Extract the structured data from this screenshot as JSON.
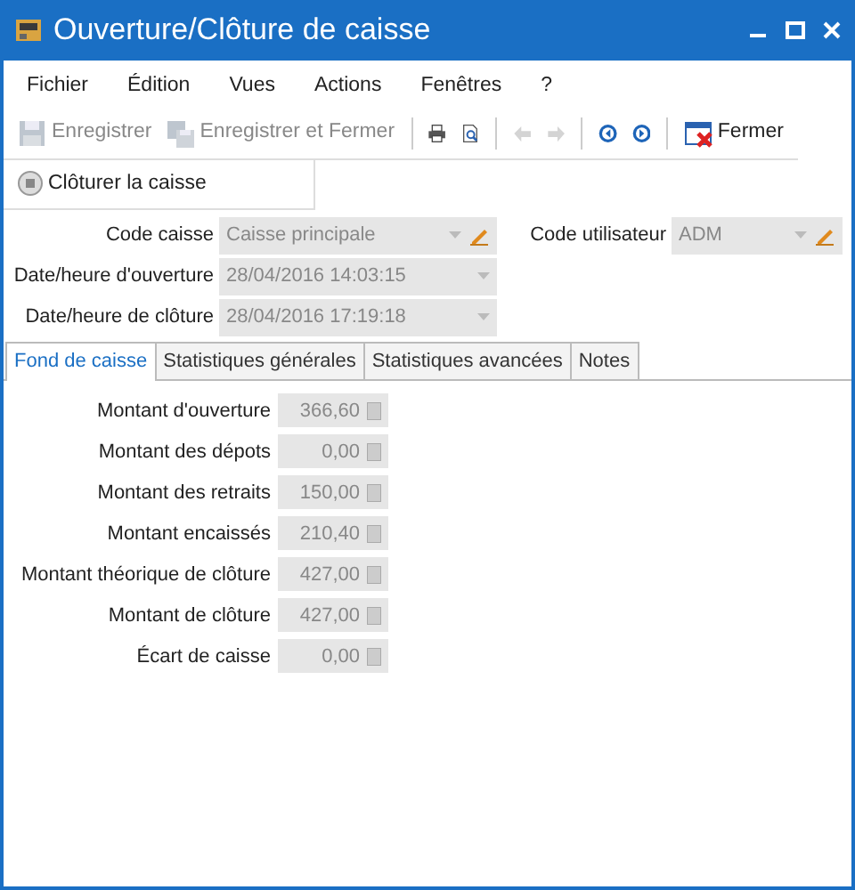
{
  "window": {
    "title": "Ouverture/Clôture de caisse"
  },
  "menu": [
    "Fichier",
    "Édition",
    "Vues",
    "Actions",
    "Fenêtres",
    "?"
  ],
  "toolbar": [
    {
      "kind": "button",
      "label": "Enregistrer",
      "disabled": true
    },
    {
      "kind": "button",
      "label": "Enregistrer et Fermer",
      "disabled": true
    },
    {
      "kind": "separator"
    },
    {
      "kind": "icon",
      "disabled": false
    },
    {
      "kind": "icon",
      "disabled": false
    },
    {
      "kind": "separator"
    },
    {
      "kind": "icon",
      "disabled": true
    },
    {
      "kind": "icon",
      "disabled": true
    },
    {
      "kind": "separator"
    },
    {
      "kind": "icon",
      "disabled": false
    },
    {
      "kind": "icon",
      "disabled": false
    },
    {
      "kind": "separator"
    },
    {
      "kind": "button",
      "label": "Fermer",
      "disabled": false
    }
  ],
  "actions": [
    {
      "label": "Clôturer la caisse",
      "disabled": false
    }
  ],
  "form": [
    [
      {
        "label": "Code caisse",
        "value": "Caisse principale",
        "disabled": true,
        "edit": true
      },
      {
        "label": "Code utilisateur",
        "value": "ADM",
        "disabled": true,
        "edit": true
      }
    ],
    [
      {
        "label": "Date/heure d'ouverture",
        "value": "28/04/2016 14:03:15",
        "disabled": true,
        "edit": false
      }
    ],
    [
      {
        "label": "Date/heure de clôture",
        "value": "28/04/2016 17:19:18",
        "disabled": true,
        "edit": false
      }
    ]
  ],
  "tabs": [
    {
      "label": "Fond de caisse",
      "selected": true
    },
    {
      "label": "Statistiques générales",
      "selected": false
    },
    {
      "label": "Statistiques avancées",
      "selected": false
    },
    {
      "label": "Notes",
      "selected": false
    }
  ],
  "amounts": [
    {
      "label": "Montant d'ouverture",
      "value": "366,60",
      "disabled": true
    },
    {
      "label": "Montant des dépots",
      "value": "0,00",
      "disabled": true
    },
    {
      "label": "Montant des retraits",
      "value": "150,00",
      "disabled": true
    },
    {
      "label": "Montant encaissés",
      "value": "210,40",
      "disabled": true
    },
    {
      "label": "Montant théorique de clôture",
      "value": "427,00",
      "disabled": true
    },
    {
      "label": "Montant de clôture",
      "value": "427,00",
      "disabled": true
    },
    {
      "label": "Écart de caisse",
      "value": "0,00",
      "disabled": true
    }
  ]
}
